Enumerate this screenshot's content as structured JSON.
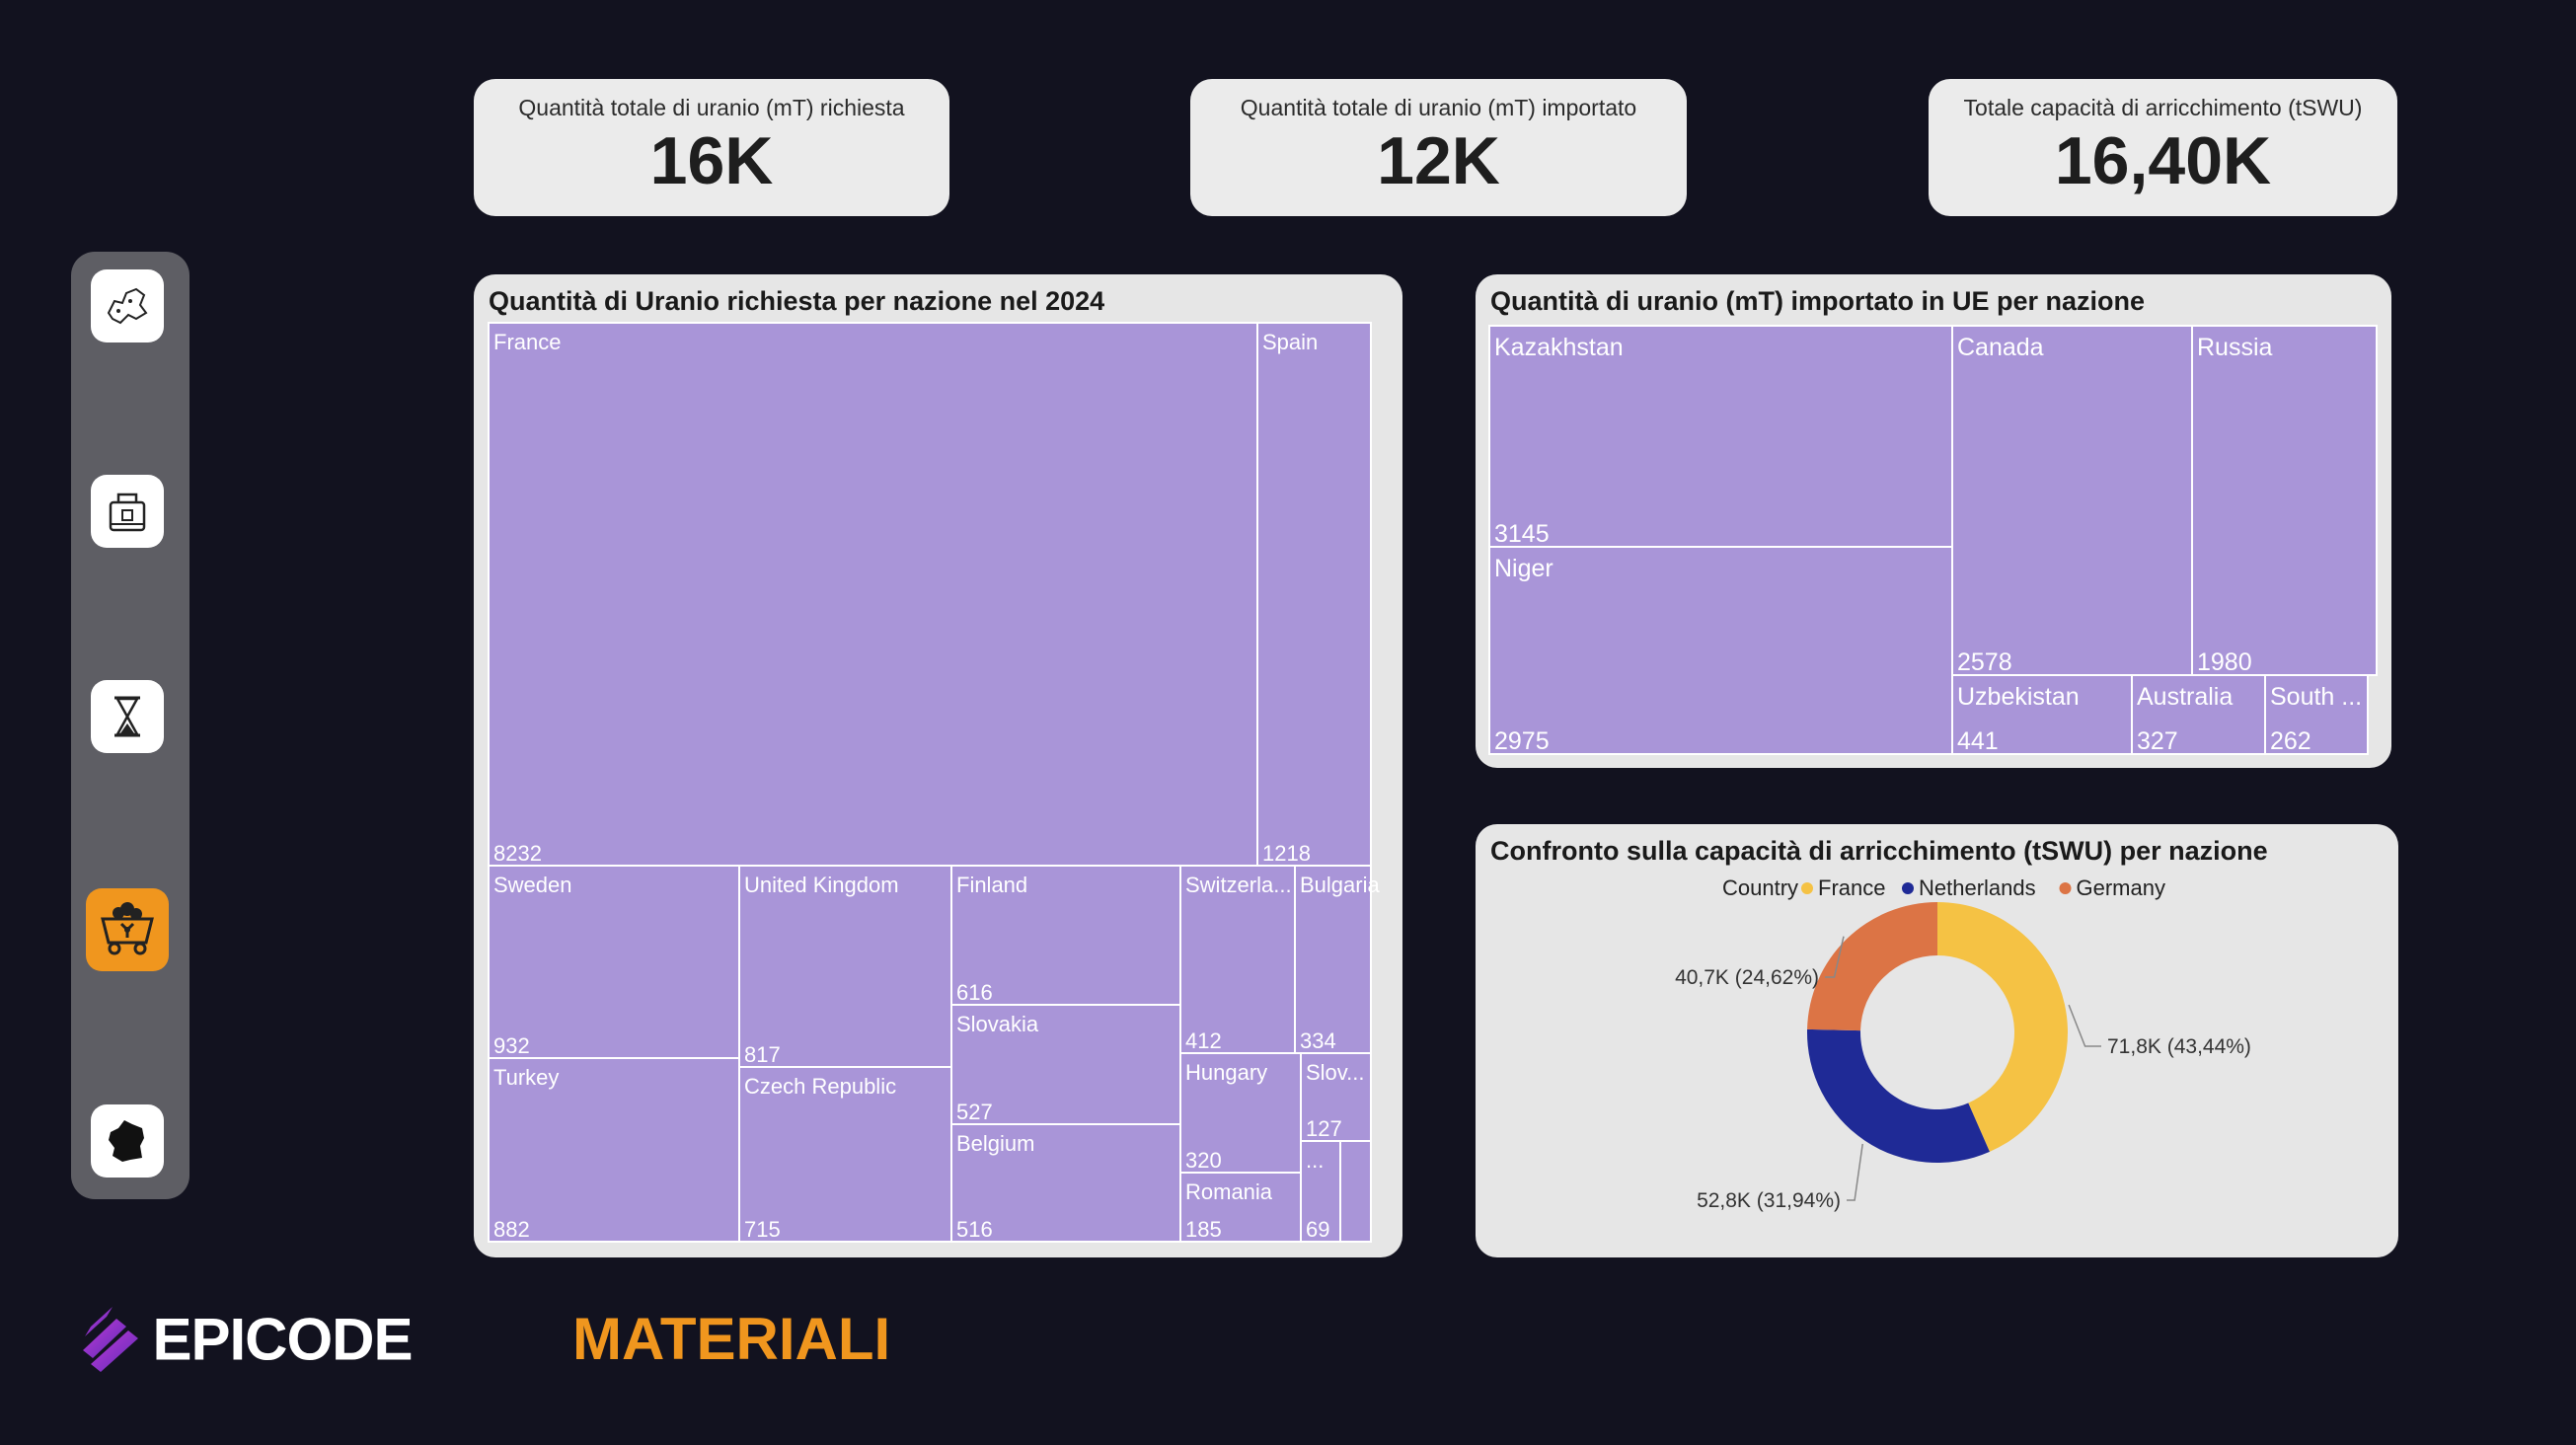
{
  "kpis": [
    {
      "label": "Quantità totale di uranio (mT) richiesta",
      "value": "16K"
    },
    {
      "label": "Quantità totale di uranio (mT) importato",
      "value": "12K"
    },
    {
      "label": "Totale capacità di arricchimento (tSWU)",
      "value": "16,40K"
    }
  ],
  "sidebar": {
    "items": [
      {
        "icon": "europe-map-icon"
      },
      {
        "icon": "reactor-building-icon"
      },
      {
        "icon": "hourglass-icon"
      },
      {
        "icon": "mine-cart-icon",
        "active": true
      },
      {
        "icon": "france-map-icon"
      }
    ],
    "active_color": "#f0961e"
  },
  "brand": {
    "logo_text": "EPICODE",
    "section_title": "MATERIALI"
  },
  "chart_data": [
    {
      "type": "treemap",
      "title": "Quantità di Uranio richiesta per nazione nel 2024",
      "color": "#a995d8",
      "items": [
        {
          "label": "France",
          "value": 8232
        },
        {
          "label": "Spain",
          "value": 1218
        },
        {
          "label": "Sweden",
          "value": 932
        },
        {
          "label": "Turkey",
          "value": 882
        },
        {
          "label": "United Kingdom",
          "value": 817
        },
        {
          "label": "Czech Republic",
          "value": 715
        },
        {
          "label": "Finland",
          "value": 616
        },
        {
          "label": "Slovakia",
          "value": 527
        },
        {
          "label": "Belgium",
          "value": 516
        },
        {
          "label": "Switzerla...",
          "value": 412
        },
        {
          "label": "Bulgaria",
          "value": 334
        },
        {
          "label": "Hungary",
          "value": 320
        },
        {
          "label": "Romania",
          "value": 185
        },
        {
          "label": "Slov...",
          "value": 127
        },
        {
          "label": "...",
          "value": 69
        },
        {
          "label": "...",
          "value": null
        }
      ]
    },
    {
      "type": "treemap",
      "title": "Quantità di uranio (mT) importato in UE per nazione",
      "color": "#a995d8",
      "items": [
        {
          "label": "Kazakhstan",
          "value": 3145
        },
        {
          "label": "Niger",
          "value": 2975
        },
        {
          "label": "Canada",
          "value": 2578
        },
        {
          "label": "Russia",
          "value": 1980
        },
        {
          "label": "Uzbekistan",
          "value": 441
        },
        {
          "label": "Australia",
          "value": 327
        },
        {
          "label": "South ...",
          "value": 262
        }
      ]
    },
    {
      "type": "pie",
      "subtype": "donut",
      "title": "Confronto sulla capacità di arricchimento (tSWU) per nazione",
      "legend_title": "Country",
      "legend_position": "top",
      "series": [
        {
          "name": "France",
          "value": 71.8,
          "label": "71,8K (43,44%)",
          "color": "#f5c244"
        },
        {
          "name": "Netherlands",
          "value": 52.8,
          "label": "52,8K (31,94%)",
          "color": "#1f2a96"
        },
        {
          "name": "Germany",
          "value": 40.7,
          "label": "40,7K (24,62%)",
          "color": "#dc7445"
        }
      ]
    }
  ]
}
